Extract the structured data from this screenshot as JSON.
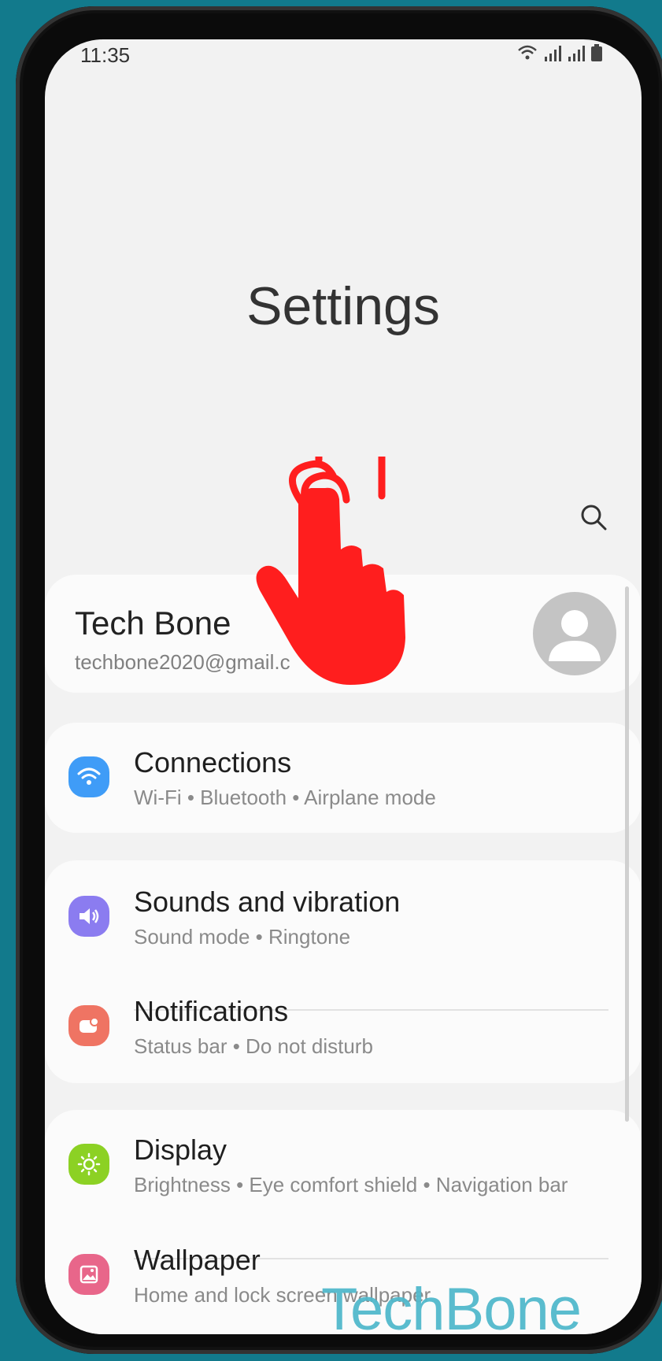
{
  "status_bar": {
    "time": "11:35"
  },
  "page": {
    "title": "Settings"
  },
  "profile": {
    "name": "Tech Bone",
    "email": "techbone2020@gmail.c"
  },
  "settings": {
    "connections": {
      "title": "Connections",
      "subtitle": "Wi-Fi  •  Bluetooth  •  Airplane mode",
      "icon": "wifi-icon",
      "color": "#3f9cf7"
    },
    "sounds": {
      "title": "Sounds and vibration",
      "subtitle": "Sound mode  •  Ringtone",
      "icon": "volume-icon",
      "color": "#8b7cf0"
    },
    "notifications": {
      "title": "Notifications",
      "subtitle": "Status bar  •  Do not disturb",
      "icon": "notification-icon",
      "color": "#ef7463"
    },
    "display": {
      "title": "Display",
      "subtitle": "Brightness  •  Eye comfort shield  •  Navigation bar",
      "icon": "brightness-icon",
      "color": "#8cd124"
    },
    "wallpaper": {
      "title": "Wallpaper",
      "subtitle": "Home and lock screen wallpaper",
      "icon": "wallpaper-icon",
      "color": "#e8668a"
    }
  },
  "overlay": {
    "watermark": "TechBone",
    "hand_color": "#ff1e1e"
  }
}
